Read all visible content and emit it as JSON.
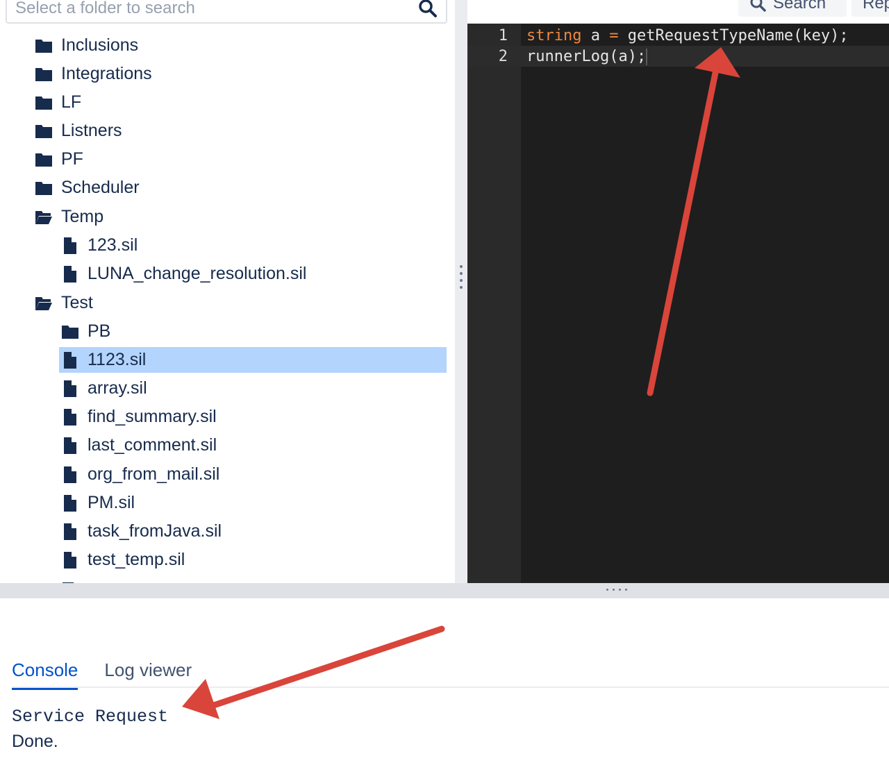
{
  "search": {
    "placeholder": "Select a folder to search"
  },
  "toolbar": {
    "search_label": "Search",
    "replace_label": "Rep"
  },
  "tree": {
    "folders_top": [
      "Inclusions",
      "Integrations",
      "LF",
      "Listners",
      "PF",
      "Scheduler"
    ],
    "temp_folder": "Temp",
    "temp_files": [
      "123.sil",
      "LUNA_change_resolution.sil"
    ],
    "test_folder": "Test",
    "test_subfolder": "PB",
    "selected_file": "1123.sil",
    "test_files": [
      "array.sil",
      "find_summary.sil",
      "last_comment.sil",
      "org_from_mail.sil",
      "PM.sil",
      "task_fromJava.sil",
      "test_temp.sil"
    ]
  },
  "editor": {
    "lines": [
      {
        "no": "1",
        "kw": "string",
        "rest_a": " a ",
        "op": "=",
        "rest_b": " getRequestTypeName(key);"
      },
      {
        "no": "2",
        "text": "runnerLog(a);"
      }
    ]
  },
  "console": {
    "tabs": [
      "Console",
      "Log viewer"
    ],
    "output_line1": "Service Request",
    "output_line2": "Done."
  },
  "colors": {
    "accent": "#0052cc",
    "selection": "#b3d4fc",
    "editor_bg": "#1e1e1e",
    "keyword": "#f0883e",
    "annotation_arrow": "#d9453a"
  },
  "icons": [
    "search-icon",
    "folder-icon",
    "folder-open-icon",
    "file-icon"
  ]
}
